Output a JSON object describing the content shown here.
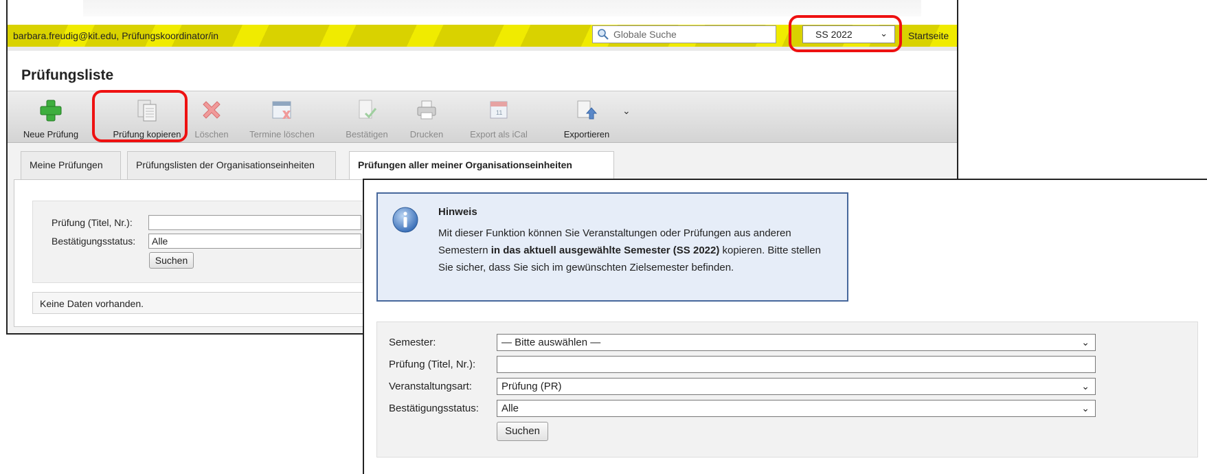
{
  "header": {
    "user_info": "barbara.freudig@kit.edu, Prüfungskoordinator/in",
    "search_placeholder": "Globale Suche",
    "semester_value": "SS 2022",
    "startseite_label": "Startseite"
  },
  "page_title": "Prüfungsliste",
  "toolbar": [
    {
      "label": "Neue Prüfung",
      "icon": "plus-icon",
      "enabled": true
    },
    {
      "label": "Prüfung kopieren",
      "icon": "copy-icon",
      "enabled": true
    },
    {
      "label": "Löschen",
      "icon": "delete-icon",
      "enabled": false
    },
    {
      "label": "Termine löschen",
      "icon": "calendar-delete-icon",
      "enabled": false
    },
    {
      "label": "Bestätigen",
      "icon": "confirm-icon",
      "enabled": false
    },
    {
      "label": "Drucken",
      "icon": "printer-icon",
      "enabled": false
    },
    {
      "label": "Export als iCal",
      "icon": "calendar-icon",
      "enabled": false
    },
    {
      "label": "Exportieren",
      "icon": "export-icon",
      "enabled": true
    }
  ],
  "tabs": [
    {
      "label": "Meine Prüfungen",
      "active": false
    },
    {
      "label": "Prüfungslisten der Organisationseinheiten",
      "active": false
    },
    {
      "label": "Prüfungen aller meiner Organisationseinheiten",
      "active": true
    }
  ],
  "bg_filter": {
    "pruefung_label": "Prüfung (Titel, Nr.):",
    "status_label": "Bestätigungsstatus:",
    "status_value": "Alle",
    "search_button": "Suchen"
  },
  "no_data": "Keine Daten vorhanden.",
  "hint": {
    "title": "Hinweis",
    "text_before": "Mit dieser Funktion können Sie Veranstaltungen oder Prüfungen aus anderen Semestern ",
    "text_bold": "in das aktuell ausgewählte Semester (SS 2022)",
    "text_after": " kopieren. Bitte stellen Sie sicher, dass Sie sich im gewünschten Zielsemester befinden."
  },
  "dialog_filter": {
    "semester_label": "Semester:",
    "semester_value": "— Bitte auswählen —",
    "pruefung_label": "Prüfung (Titel, Nr.):",
    "veranstaltungsart_label": "Veranstaltungsart:",
    "veranstaltungsart_value": "Prüfung (PR)",
    "status_label": "Bestätigungsstatus:",
    "status_value": "Alle",
    "search_button": "Suchen"
  },
  "colors": {
    "highlight": "#ee1111",
    "header_yellow": "#e5df00",
    "hint_border": "#46679b",
    "hint_background": "#e6edf8"
  }
}
